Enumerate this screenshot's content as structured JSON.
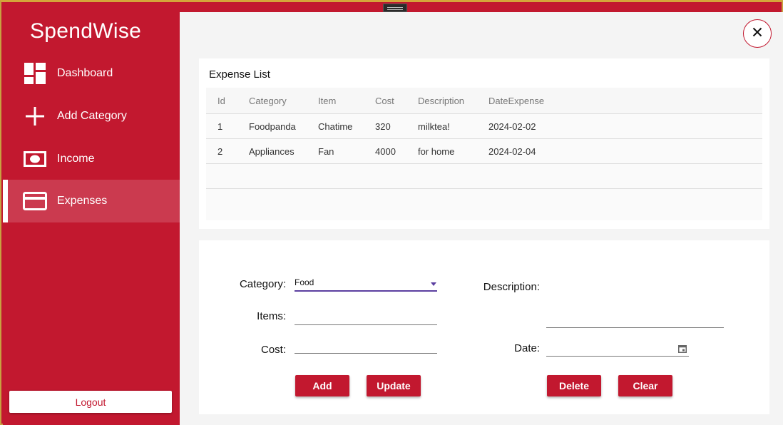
{
  "app": {
    "title": "SpendWise"
  },
  "sidebar": {
    "items": [
      {
        "label": "Dashboard",
        "icon": "dashboard-icon"
      },
      {
        "label": "Add Category",
        "icon": "plus-icon"
      },
      {
        "label": "Income",
        "icon": "cash-icon"
      },
      {
        "label": "Expenses",
        "icon": "credit-card-icon",
        "active": true
      }
    ],
    "logout_label": "Logout"
  },
  "expense_list": {
    "title": "Expense List",
    "columns": [
      "Id",
      "Category",
      "Item",
      "Cost",
      "Description",
      "DateExpense"
    ],
    "rows": [
      [
        "1",
        "Foodpanda",
        "Chatime",
        "320",
        "milktea!",
        "2024-02-02"
      ],
      [
        "2",
        "Appliances",
        "Fan",
        "4000",
        "for home",
        "2024-02-04"
      ]
    ]
  },
  "form": {
    "category_label": "Category:",
    "category_value": "Food",
    "items_label": "Items:",
    "items_value": "",
    "cost_label": "Cost:",
    "cost_value": "",
    "description_label": "Description:",
    "description_value": "",
    "date_label": "Date:",
    "date_value": "",
    "add_label": "Add",
    "update_label": "Update",
    "delete_label": "Delete",
    "clear_label": "Clear"
  },
  "colors": {
    "primary": "#c2182f",
    "accent": "#5b3fa0"
  }
}
